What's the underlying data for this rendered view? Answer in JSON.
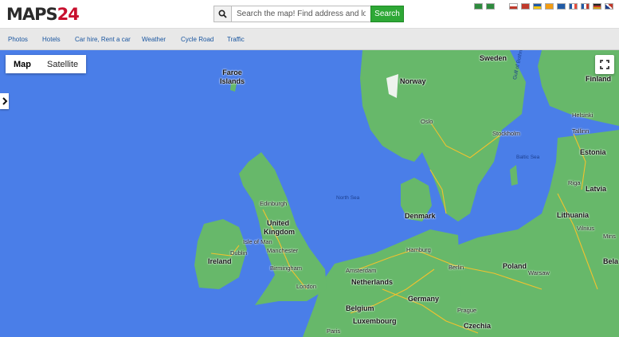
{
  "header": {
    "logo_maps": "MAPS",
    "logo_num": "24",
    "search_placeholder": "Search the map! Find address and local bu",
    "search_button": "Search",
    "search_icon": "magnifier-icon",
    "flag_colors": [
      "#2e8b3e",
      "#2e8b3e",
      "#c0392b",
      "#c0392b",
      "#f1c40f",
      "#f39c12",
      "#1f5aa6",
      "#e74c3c",
      "#1f5aa6",
      "#c0392b",
      "#d4a017",
      "#c0392b"
    ]
  },
  "nav": {
    "items": [
      {
        "label": "Photos"
      },
      {
        "label": "Hotels"
      },
      {
        "label": "Car hire, Rent a car"
      },
      {
        "label": "Weather"
      },
      {
        "label": "Cycle Road"
      },
      {
        "label": "Traffic"
      }
    ]
  },
  "map": {
    "type_map": "Map",
    "type_satellite": "Satellite",
    "fullscreen_icon": "fullscreen-icon",
    "expand_icon": "chevron-right-icon",
    "colors": {
      "sea": "#4a7ee8",
      "land": "#67b86a",
      "roads": "#f2c12e"
    },
    "labels": {
      "sweden": "Sweden",
      "finland": "Finland",
      "faroe": "Faroe\nIslands",
      "norway": "Norway",
      "gulf": "Gulf of Bothnia",
      "helsinki": "Helsinki",
      "tallinn": "Tallinn",
      "estonia": "Estonia",
      "oslo": "Oslo",
      "stockholm": "Stockholm",
      "baltic": "Baltic Sea",
      "riga": "Riga",
      "latvia": "Latvia",
      "edinburgh": "Edinburgh",
      "northsea": "North Sea",
      "denmark": "Denmark",
      "lithuania": "Lithuania",
      "uk1": "United",
      "uk2": "Kingdom",
      "vilnius": "Vilnius",
      "minsk": "Mins",
      "belarus": "Bela",
      "isleofman": "Isle of Man",
      "hamburg": "Hamburg",
      "manchester": "Manchester",
      "dublin": "Dublin",
      "ireland": "Ireland",
      "birmingham": "Birmingham",
      "poland": "Poland",
      "berlin": "Berlin",
      "amsterdam": "Amsterdam",
      "warsaw": "Warsaw",
      "netherlands": "Netherlands",
      "london": "London",
      "germany": "Germany",
      "belgium": "Belgium",
      "prague": "Prague",
      "luxembourg": "Luxembourg",
      "czechia": "Czechia",
      "paris": "Paris"
    }
  }
}
